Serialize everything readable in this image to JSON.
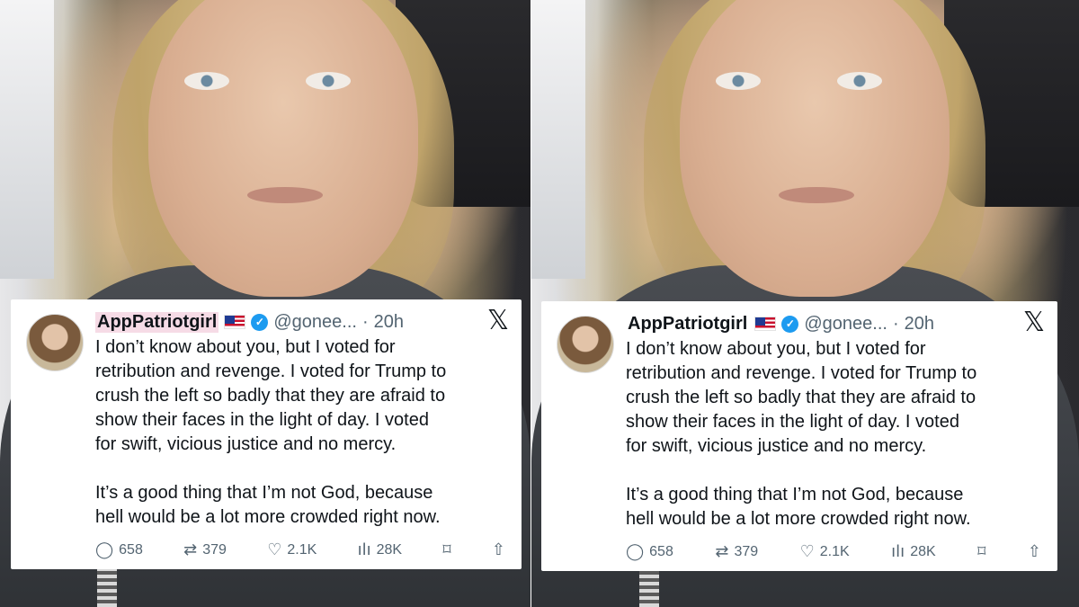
{
  "tweet": {
    "display_name": "AppPatriotgirl",
    "handle": "@gonee...",
    "separator": "·",
    "time": "20h",
    "verified_glyph": "✓",
    "x_logo": "𝕏",
    "text": "I don’t know about you, but I voted for\nretribution and revenge. I voted for Trump to\ncrush the left so badly that they are afraid to\nshow their faces in the light of day. I voted\nfor swift, vicious justice and no mercy.\n\nIt’s a good thing that I’m not God, because\nhell would be a lot more crowded right now.",
    "stats": {
      "replies": "658",
      "reposts": "379",
      "likes": "2.1K",
      "views": "28K"
    },
    "icons": {
      "reply": "◯",
      "repost": "⇄",
      "like": "♡",
      "views": "ılı",
      "bookmark": "⌑",
      "share": "⇧"
    }
  }
}
